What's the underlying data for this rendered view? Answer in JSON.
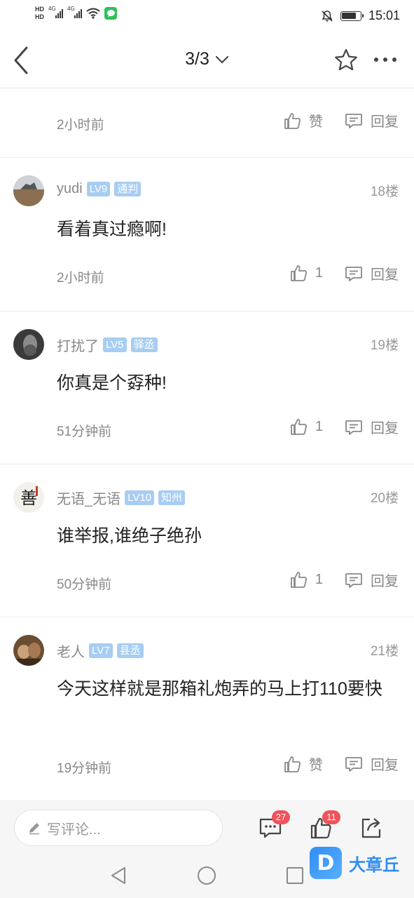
{
  "status_bar": {
    "hd1": "HD",
    "hd2": "HD",
    "net1": "4G",
    "net2": "4G",
    "time": "15:01",
    "battery_level": 0.8
  },
  "nav": {
    "title": "3/3"
  },
  "first_footer": {
    "time": "2小时前",
    "like_label": "赞",
    "reply_label": "回复"
  },
  "comments": [
    {
      "username": "yudi",
      "level": "LV9",
      "rank": "通判",
      "floor": "18楼",
      "text": "看着真过瘾啊!",
      "time": "2小时前",
      "likes": "1",
      "reply_label": "回复"
    },
    {
      "username": "打扰了",
      "level": "LV5",
      "rank": "驿丞",
      "floor": "19楼",
      "text": "你真是个孬种!",
      "time": "51分钟前",
      "likes": "1",
      "reply_label": "回复"
    },
    {
      "username": "无语_无语",
      "level": "LV10",
      "rank": "知州",
      "floor": "20楼",
      "text": "谁举报,谁绝子绝孙",
      "time": "50分钟前",
      "likes": "1",
      "reply_label": "回复"
    },
    {
      "username": "老人",
      "level": "LV7",
      "rank": "县丞",
      "floor": "21楼",
      "text": "今天这样就是那箱礼炮弄的马上打110要快",
      "time": "19分钟前",
      "likes": "赞",
      "reply_label": "回复"
    }
  ],
  "bottom_bar": {
    "comment_placeholder": "写评论...",
    "comment_count": "27",
    "like_count": "11"
  },
  "watermark": {
    "logo": "D",
    "text": "大章丘"
  }
}
